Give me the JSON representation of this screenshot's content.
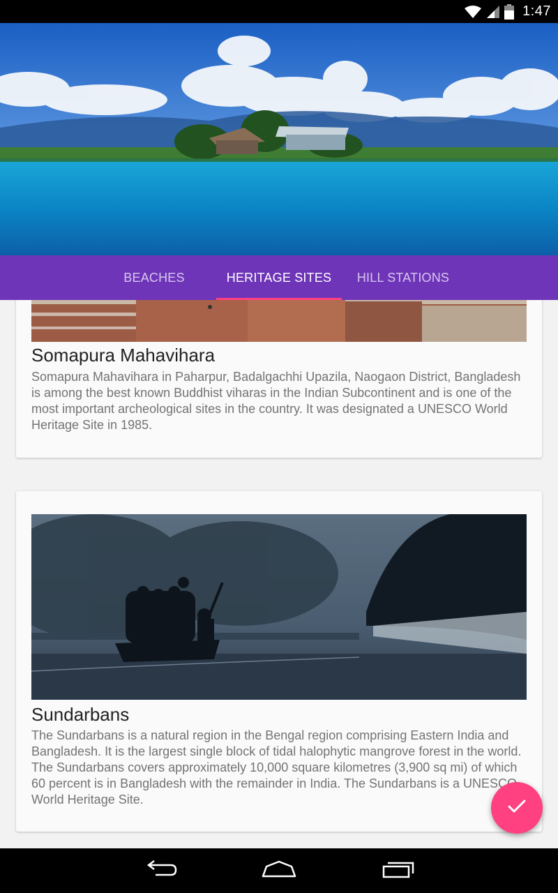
{
  "status_bar": {
    "time": "1:47",
    "icons": [
      "wifi-icon",
      "cell-signal-icon",
      "battery-icon"
    ]
  },
  "header": {
    "image": "river-landscape-header-image"
  },
  "tabs": [
    {
      "label": "BEACHES",
      "active": false
    },
    {
      "label": "HERITAGE SITES",
      "active": true
    },
    {
      "label": "HILL STATIONS",
      "active": false
    }
  ],
  "cards": [
    {
      "title": "Somapura Mahavihara",
      "description": "Somapura Mahavihara in Paharpur, Badalgachhi Upazila, Naogaon District, Bangladesh is among the best known Buddhist viharas in the Indian Subcontinent and is one of the most important archeological sites in the country. It was designated a UNESCO World Heritage Site in 1985."
    },
    {
      "title": "Sundarbans",
      "description": "The Sundarbans is a natural region in the Bengal region comprising Eastern India and Bangladesh. It is the largest single block of tidal halophytic mangrove forest in the world. The Sundarbans covers approximately 10,000 square kilometres (3,900 sq mi) of which 60 percent is in Bangladesh with the remainder in India. The Sundarbans is a UNESCO World Heritage Site."
    }
  ],
  "fab": {
    "icon": "check-icon"
  },
  "nav_bar": {
    "icons": [
      "back-icon",
      "home-icon",
      "recents-icon"
    ]
  },
  "colors": {
    "tab_bar": "#6f35b9",
    "accent": "#ff4081",
    "card_background": "#fafafa",
    "page_background": "#f2f2f2"
  }
}
